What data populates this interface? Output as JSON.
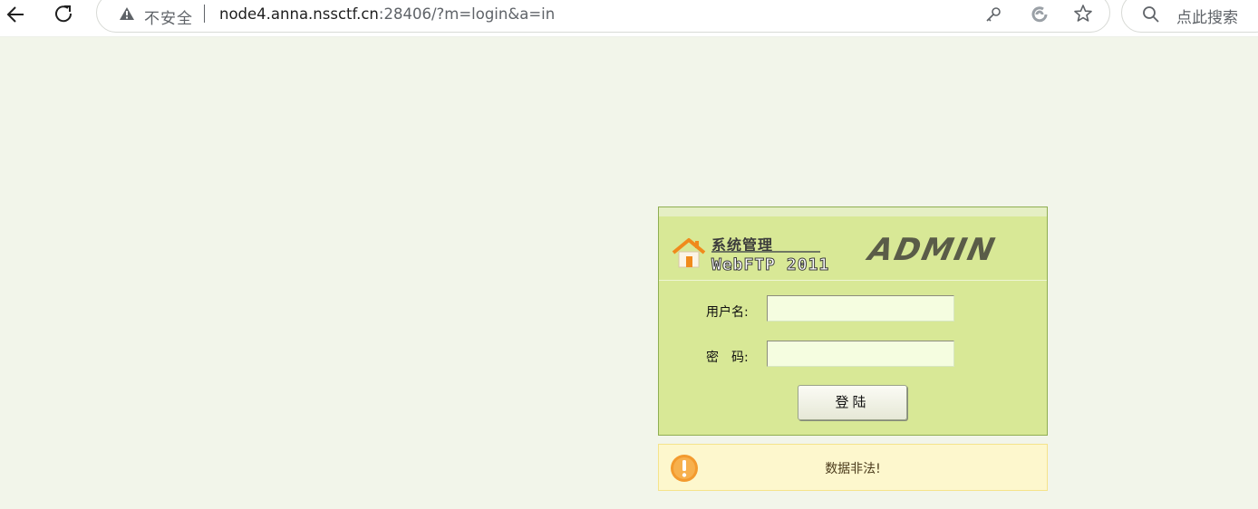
{
  "browser": {
    "security_label": "不安全",
    "url_host": "node4.anna.nssctf.cn",
    "url_rest": ":28406/?m=login&a=in",
    "search_placeholder": "点此搜索",
    "icons": [
      "back-arrow-icon",
      "reload-icon",
      "warning-triangle-icon",
      "key-icon",
      "edge-refresh-icon",
      "star-icon",
      "search-icon"
    ]
  },
  "login": {
    "header_title": "系统管理",
    "header_product": "WebFTP 2011",
    "header_admin": "ADMIN",
    "username_label": "用户名:",
    "username_value": "",
    "password_label": "密　码:",
    "password_value": "",
    "submit_label": "登陆"
  },
  "alert": {
    "message": "数据非法!",
    "icon": "exclamation-circle-icon"
  },
  "colors": {
    "page_bg": "#f2f5ea",
    "panel_bg": "#d8e896",
    "input_bg": "#f5fde0",
    "alert_bg": "#fdf7cd",
    "alert_icon": "#f39a2e"
  }
}
